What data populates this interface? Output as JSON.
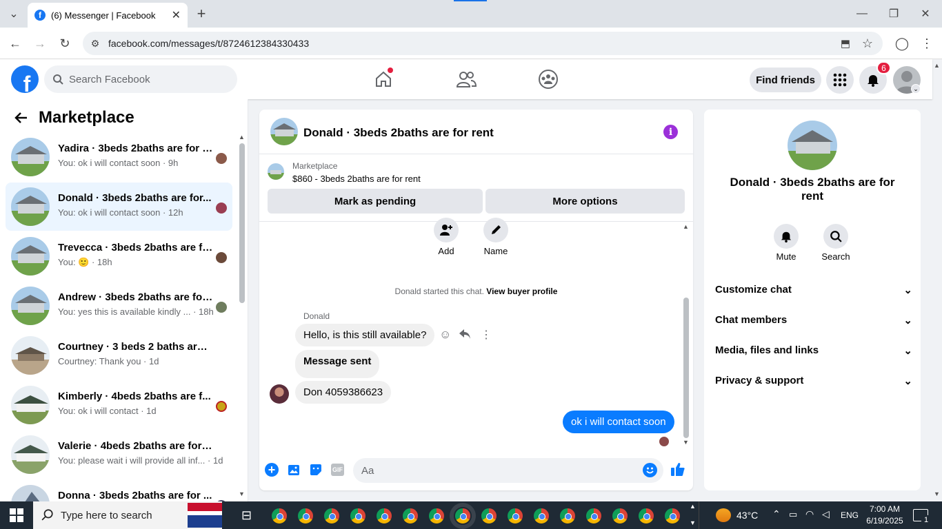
{
  "browser": {
    "tab_title": "(6) Messenger | Facebook",
    "url": "facebook.com/messages/t/8724612384330433"
  },
  "header": {
    "search_placeholder": "Search Facebook",
    "find_friends": "Find friends",
    "notification_count": "6"
  },
  "sidebar": {
    "title": "Marketplace",
    "conversations": [
      {
        "name": "Yadira · 3beds 2baths are for r...",
        "preview": "You: ok i will contact soon · 9h"
      },
      {
        "name": "Donald · 3beds 2baths are for...",
        "preview": "You: ok i will contact soon · 12h"
      },
      {
        "name": "Trevecca · 3beds 2baths are fo...",
        "preview": "You: 🙂 · 18h"
      },
      {
        "name": "Andrew · 3beds 2baths are for...",
        "preview": "You: yes this is available kindly ... · 18h"
      },
      {
        "name": "Courtney · 3 beds 2 baths are fo...",
        "preview": "Courtney: Thank you · 1d"
      },
      {
        "name": "Kimberly · 4beds 2baths are f...",
        "preview": "You: ok i will contact · 1d"
      },
      {
        "name": "Valerie · 4beds 2baths are for rent",
        "preview": "You: please wait i will provide all inf... · 1d"
      },
      {
        "name": "Donna · 3beds 2baths are for ...",
        "preview": ""
      }
    ]
  },
  "chat": {
    "title": "Donald · 3beds 2baths are for rent",
    "marketplace_label": "Marketplace",
    "listing": "$860 - 3beds 2baths are for rent",
    "mark_pending": "Mark as pending",
    "more_options": "More options",
    "add_label": "Add",
    "name_label": "Name",
    "started_text": "Donald started this chat.",
    "view_profile": "View buyer profile",
    "sender_name": "Donald",
    "messages": [
      "Hello, is this still available?",
      "Message sent",
      "Don 4059386623"
    ],
    "outgoing": "ok i will contact soon",
    "composer_placeholder": "Aa"
  },
  "info_panel": {
    "name": "Donald · 3beds 2baths are for rent",
    "mute": "Mute",
    "search": "Search",
    "sections": [
      "Customize chat",
      "Chat members",
      "Media, files and links",
      "Privacy & support"
    ]
  },
  "taskbar": {
    "search_placeholder": "Type here to search",
    "temperature": "43°C",
    "language": "ENG",
    "time": "7:00 AM",
    "date": "6/19/2025",
    "notif_count": "1"
  },
  "colors": {
    "accent": "#1877f2",
    "outgoing_bubble": "#0a7cff",
    "info_icon": "#9b30d9",
    "badge": "#e41e3f"
  }
}
